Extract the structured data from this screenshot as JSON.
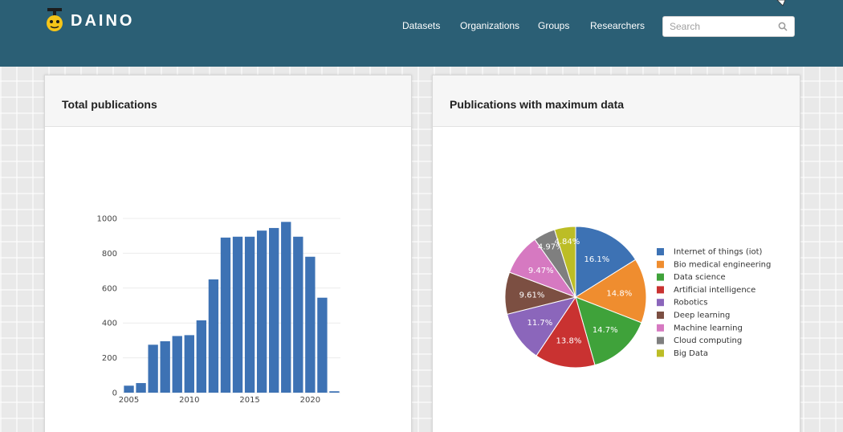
{
  "header": {
    "brand": "DAINO",
    "nav": [
      {
        "label": "Datasets"
      },
      {
        "label": "Organizations"
      },
      {
        "label": "Groups"
      },
      {
        "label": "Researchers"
      }
    ],
    "search_placeholder": "Search",
    "colors": {
      "masthead": "#2b5f75",
      "logo_bulb": "#f5c518"
    }
  },
  "panels": {
    "left_title": "Total publications",
    "right_title": "Publications with maximum data"
  },
  "chart_data": [
    {
      "type": "bar",
      "title": "Total publications",
      "x": [
        2005,
        2006,
        2007,
        2008,
        2009,
        2010,
        2011,
        2012,
        2013,
        2014,
        2015,
        2016,
        2017,
        2018,
        2019,
        2020,
        2021,
        2022
      ],
      "values": [
        40,
        55,
        275,
        295,
        325,
        330,
        415,
        650,
        890,
        895,
        895,
        930,
        945,
        980,
        895,
        780,
        545,
        8
      ],
      "x_ticks": [
        2005,
        2010,
        2015,
        2020
      ],
      "y_ticks": [
        0,
        200,
        400,
        600,
        800,
        1000
      ],
      "ylim": [
        0,
        1000
      ],
      "grid": true,
      "color": "#3d72b4"
    },
    {
      "type": "pie",
      "title": "Publications with maximum data",
      "labels": [
        "Internet of things (iot)",
        "Bio medical engineering",
        "Data science",
        "Artificial intelligence",
        "Robotics",
        "Deep learning",
        "Machine learning",
        "Cloud computing",
        "Big Data"
      ],
      "values": [
        16.1,
        14.8,
        14.7,
        13.8,
        11.7,
        9.61,
        9.47,
        4.97,
        4.84
      ],
      "display_labels": [
        "16.1%",
        "14.8%",
        "14.7%",
        "13.8%",
        "11.7%",
        "9.61%",
        "9.47%",
        "4.97%",
        "4.84%"
      ],
      "colors": [
        "#3d72b4",
        "#ef8d2f",
        "#3fa23a",
        "#c93231",
        "#8b66bb",
        "#7c4f42",
        "#d679c1",
        "#7f7f7f",
        "#bcbd26"
      ],
      "legend_placement": "right"
    }
  ]
}
